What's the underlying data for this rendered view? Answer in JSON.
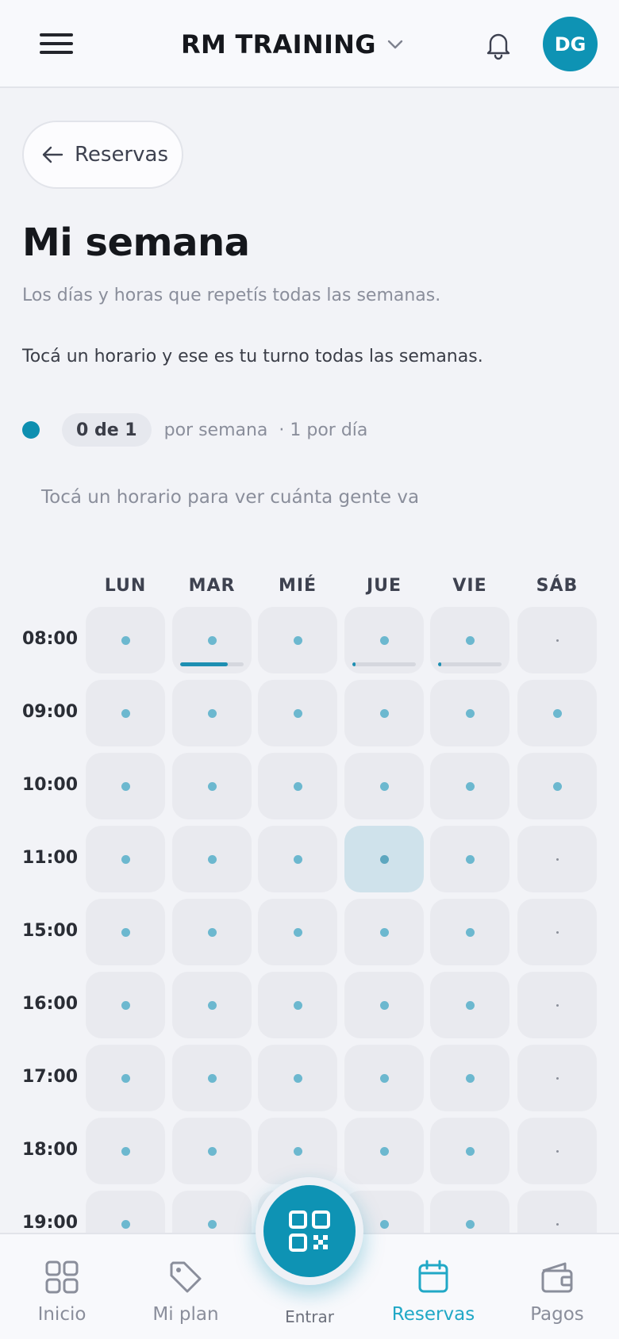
{
  "header": {
    "title": "RM TRAINING",
    "avatar_initials": "DG",
    "accent": "#0e93b4"
  },
  "back": {
    "label": "Reservas"
  },
  "page": {
    "title": "Mi semana",
    "subtitle": "Los días y horas que repetís todas las semanas.",
    "instruction": "Tocá un horario y ese es tu turno todas las semanas."
  },
  "quota": {
    "count": "0 de 1",
    "per": "por semana",
    "daily": "· 1 por día"
  },
  "hint": "Tocá un horario para ver cuánta gente va",
  "schedule": {
    "days": [
      "LUN",
      "MAR",
      "MIÉ",
      "JUE",
      "VIE",
      "SÁB"
    ],
    "times": [
      "08:00",
      "09:00",
      "10:00",
      "11:00",
      "15:00",
      "16:00",
      "17:00",
      "18:00",
      "19:00"
    ],
    "cells": [
      [
        "dot",
        "dot",
        "dot",
        "dot",
        "dot",
        "small"
      ],
      [
        "dot",
        "dot",
        "dot",
        "dot",
        "dot",
        "dot"
      ],
      [
        "dot",
        "dot",
        "dot",
        "dot",
        "dot",
        "dot"
      ],
      [
        "dot",
        "dot",
        "dot",
        "selected",
        "dot",
        "small"
      ],
      [
        "dot",
        "dot",
        "dot",
        "dot",
        "dot",
        "small"
      ],
      [
        "dot",
        "dot",
        "dot",
        "dot",
        "dot",
        "small"
      ],
      [
        "dot",
        "dot",
        "dot",
        "dot",
        "dot",
        "small"
      ],
      [
        "dot",
        "dot",
        "dot",
        "dot",
        "dot",
        "small"
      ],
      [
        "dot",
        "dot",
        "dot",
        "dot",
        "dot",
        "small"
      ]
    ],
    "occupancy_0800": [
      null,
      0.75,
      null,
      0.05,
      0.05,
      null
    ]
  },
  "bottom_nav": {
    "items": [
      {
        "label": "Inicio",
        "icon": "grid-icon"
      },
      {
        "label": "Mi plan",
        "icon": "tag-icon"
      },
      {
        "label": "Reservas",
        "icon": "calendar-icon",
        "active": true
      },
      {
        "label": "Pagos",
        "icon": "wallet-icon"
      }
    ],
    "qr_label": "Entrar"
  }
}
